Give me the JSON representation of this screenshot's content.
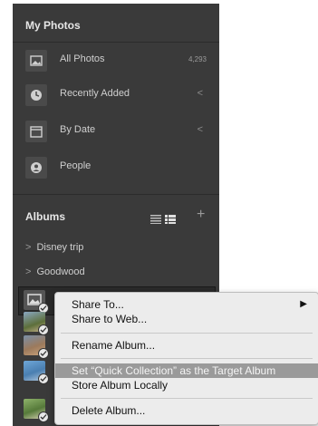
{
  "my_photos": {
    "title": "My Photos",
    "items": [
      {
        "label": "All Photos",
        "count": "4,293",
        "icon": "photo-icon"
      },
      {
        "label": "Recently Added",
        "chevron": "<",
        "icon": "clock-icon"
      },
      {
        "label": "By Date",
        "chevron": "<",
        "icon": "calendar-icon"
      },
      {
        "label": "People",
        "icon": "person-icon"
      }
    ]
  },
  "albums": {
    "title": "Albums",
    "add_glyph": "+",
    "items": [
      {
        "caret": ">",
        "label": "Disney trip"
      },
      {
        "caret": ">",
        "label": "Goodwood"
      }
    ]
  },
  "context_menu": {
    "share_to": "Share To...",
    "submenu_arrow": "▶",
    "share_to_web": "Share to Web...",
    "rename_album": "Rename Album...",
    "set_quick_collection": "Set “Quick Collection” as the Target Album",
    "store_album_locally": "Store Album Locally",
    "delete_album": "Delete Album..."
  },
  "colors": {
    "panel": "#3a3a3a",
    "menu": "#ececec",
    "highlight": "#9a9a9a"
  }
}
